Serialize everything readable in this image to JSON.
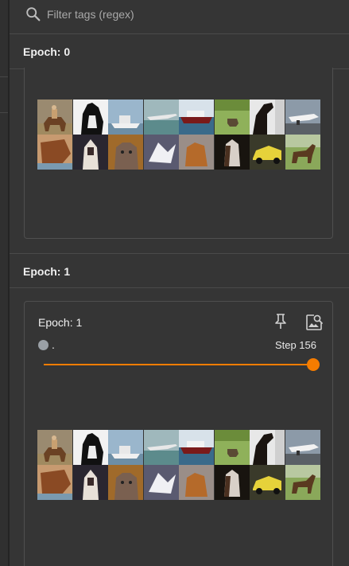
{
  "filter": {
    "placeholder": "Filter tags (regex)",
    "icon": "search-icon"
  },
  "groups": [
    {
      "header": "Epoch: 0"
    },
    {
      "header": "Epoch: 1",
      "card": {
        "title": "Epoch: 1",
        "run_name": ".",
        "step_label": "Step 156",
        "step_fraction": 1.0,
        "accent_color": "#f57c00",
        "run_color": "#9aa0a6",
        "icons": [
          "pin-icon",
          "image-search-icon"
        ]
      }
    }
  ],
  "image_grid": {
    "rows": 2,
    "cols": 8,
    "cells": [
      [
        "person-on-horse",
        "black-white-cat",
        "white-boat",
        "airplane-over-water",
        "ship",
        "deer-on-grass",
        "black-horse",
        "white-airplane"
      ],
      [
        "brown-cat",
        "dog-dark",
        "tabby-cat",
        "white-bird",
        "brown-dog",
        "dog-face",
        "yellow-car",
        "horse"
      ]
    ]
  }
}
